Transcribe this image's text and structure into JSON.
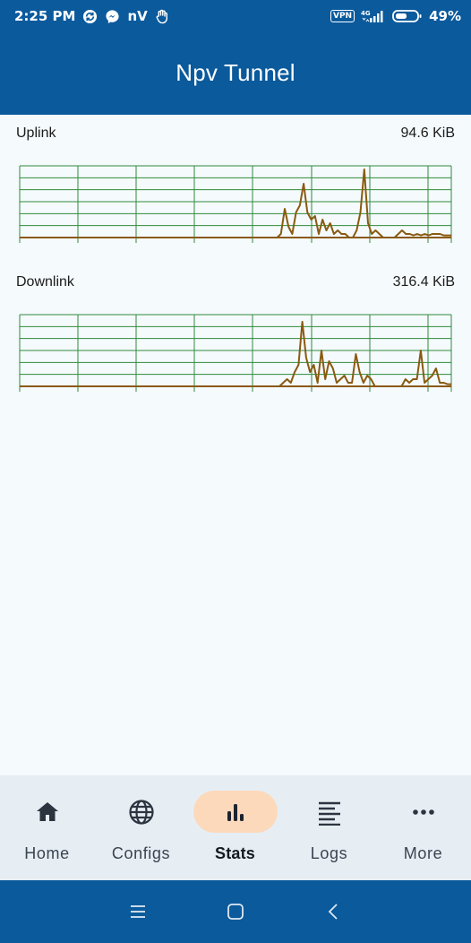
{
  "status_bar": {
    "time": "2:25 PM",
    "carrier_badge": "nV",
    "vpn_label": "VPN",
    "network": "4G",
    "battery": "49%",
    "icons": [
      "sync-icon",
      "messenger-icon",
      "hand-icon",
      "signal-icon",
      "battery-icon"
    ]
  },
  "app_bar": {
    "title": "Npv Tunnel"
  },
  "colors": {
    "brand": "#0a5a9c",
    "grid": "#2e8b3a",
    "trace": "#8a5a10",
    "active_pill": "#fdd9bc",
    "background": "#f5fafd"
  },
  "graphs": [
    {
      "label": "Uplink",
      "value": "94.6 KiB",
      "trace": [
        0,
        0,
        0,
        0,
        0,
        0,
        0,
        0,
        0,
        0,
        0,
        0,
        0,
        0,
        0,
        0,
        0,
        0,
        0,
        0,
        0,
        0,
        0,
        0,
        0,
        0,
        0,
        0,
        0,
        0,
        0,
        0,
        0,
        0,
        0,
        0,
        0,
        0,
        0,
        0,
        0,
        0,
        0,
        0,
        0,
        0,
        0,
        0,
        0,
        0,
        0,
        0,
        0,
        0,
        0,
        0,
        0,
        0,
        0,
        0,
        0,
        0,
        0,
        0,
        0,
        0,
        0,
        0,
        0,
        0.05,
        0.4,
        0.15,
        0.05,
        0.35,
        0.45,
        0.75,
        0.35,
        0.25,
        0.3,
        0.05,
        0.25,
        0.1,
        0.2,
        0.05,
        0.1,
        0.05,
        0.05,
        0,
        0,
        0.1,
        0.35,
        0.95,
        0.2,
        0.05,
        0.1,
        0.05,
        0,
        0,
        0,
        0,
        0.05,
        0.1,
        0.05,
        0.05,
        0.03,
        0.05,
        0.03,
        0.05,
        0.03,
        0.05,
        0.05,
        0.05,
        0.03,
        0.03,
        0.03
      ]
    },
    {
      "label": "Downlink",
      "value": "316.4 KiB",
      "trace": [
        0,
        0,
        0,
        0,
        0,
        0,
        0,
        0,
        0,
        0,
        0,
        0,
        0,
        0,
        0,
        0,
        0,
        0,
        0,
        0,
        0,
        0,
        0,
        0,
        0,
        0,
        0,
        0,
        0,
        0,
        0,
        0,
        0,
        0,
        0,
        0,
        0,
        0,
        0,
        0,
        0,
        0,
        0,
        0,
        0,
        0,
        0,
        0,
        0,
        0,
        0,
        0,
        0,
        0,
        0,
        0,
        0,
        0,
        0,
        0,
        0,
        0,
        0,
        0,
        0,
        0,
        0,
        0,
        0,
        0.05,
        0.1,
        0.05,
        0.2,
        0.3,
        0.9,
        0.4,
        0.2,
        0.3,
        0.05,
        0.5,
        0.1,
        0.35,
        0.25,
        0.05,
        0.1,
        0.15,
        0.05,
        0.05,
        0.45,
        0.2,
        0.05,
        0.15,
        0.1,
        0,
        0,
        0,
        0,
        0,
        0,
        0,
        0,
        0.1,
        0.05,
        0.1,
        0.1,
        0.5,
        0.05,
        0.1,
        0.15,
        0.25,
        0.05,
        0.05,
        0.03,
        0.03
      ]
    }
  ],
  "nav": {
    "items": [
      {
        "label": "Home",
        "icon": "home-icon",
        "active": false
      },
      {
        "label": "Configs",
        "icon": "globe-icon",
        "active": false
      },
      {
        "label": "Stats",
        "icon": "bar-chart-icon",
        "active": true
      },
      {
        "label": "Logs",
        "icon": "list-icon",
        "active": false
      },
      {
        "label": "More",
        "icon": "more-horizontal-icon",
        "active": false
      }
    ]
  },
  "system_nav": {
    "icons": [
      "menu-icon",
      "home-square-icon",
      "back-icon"
    ]
  }
}
